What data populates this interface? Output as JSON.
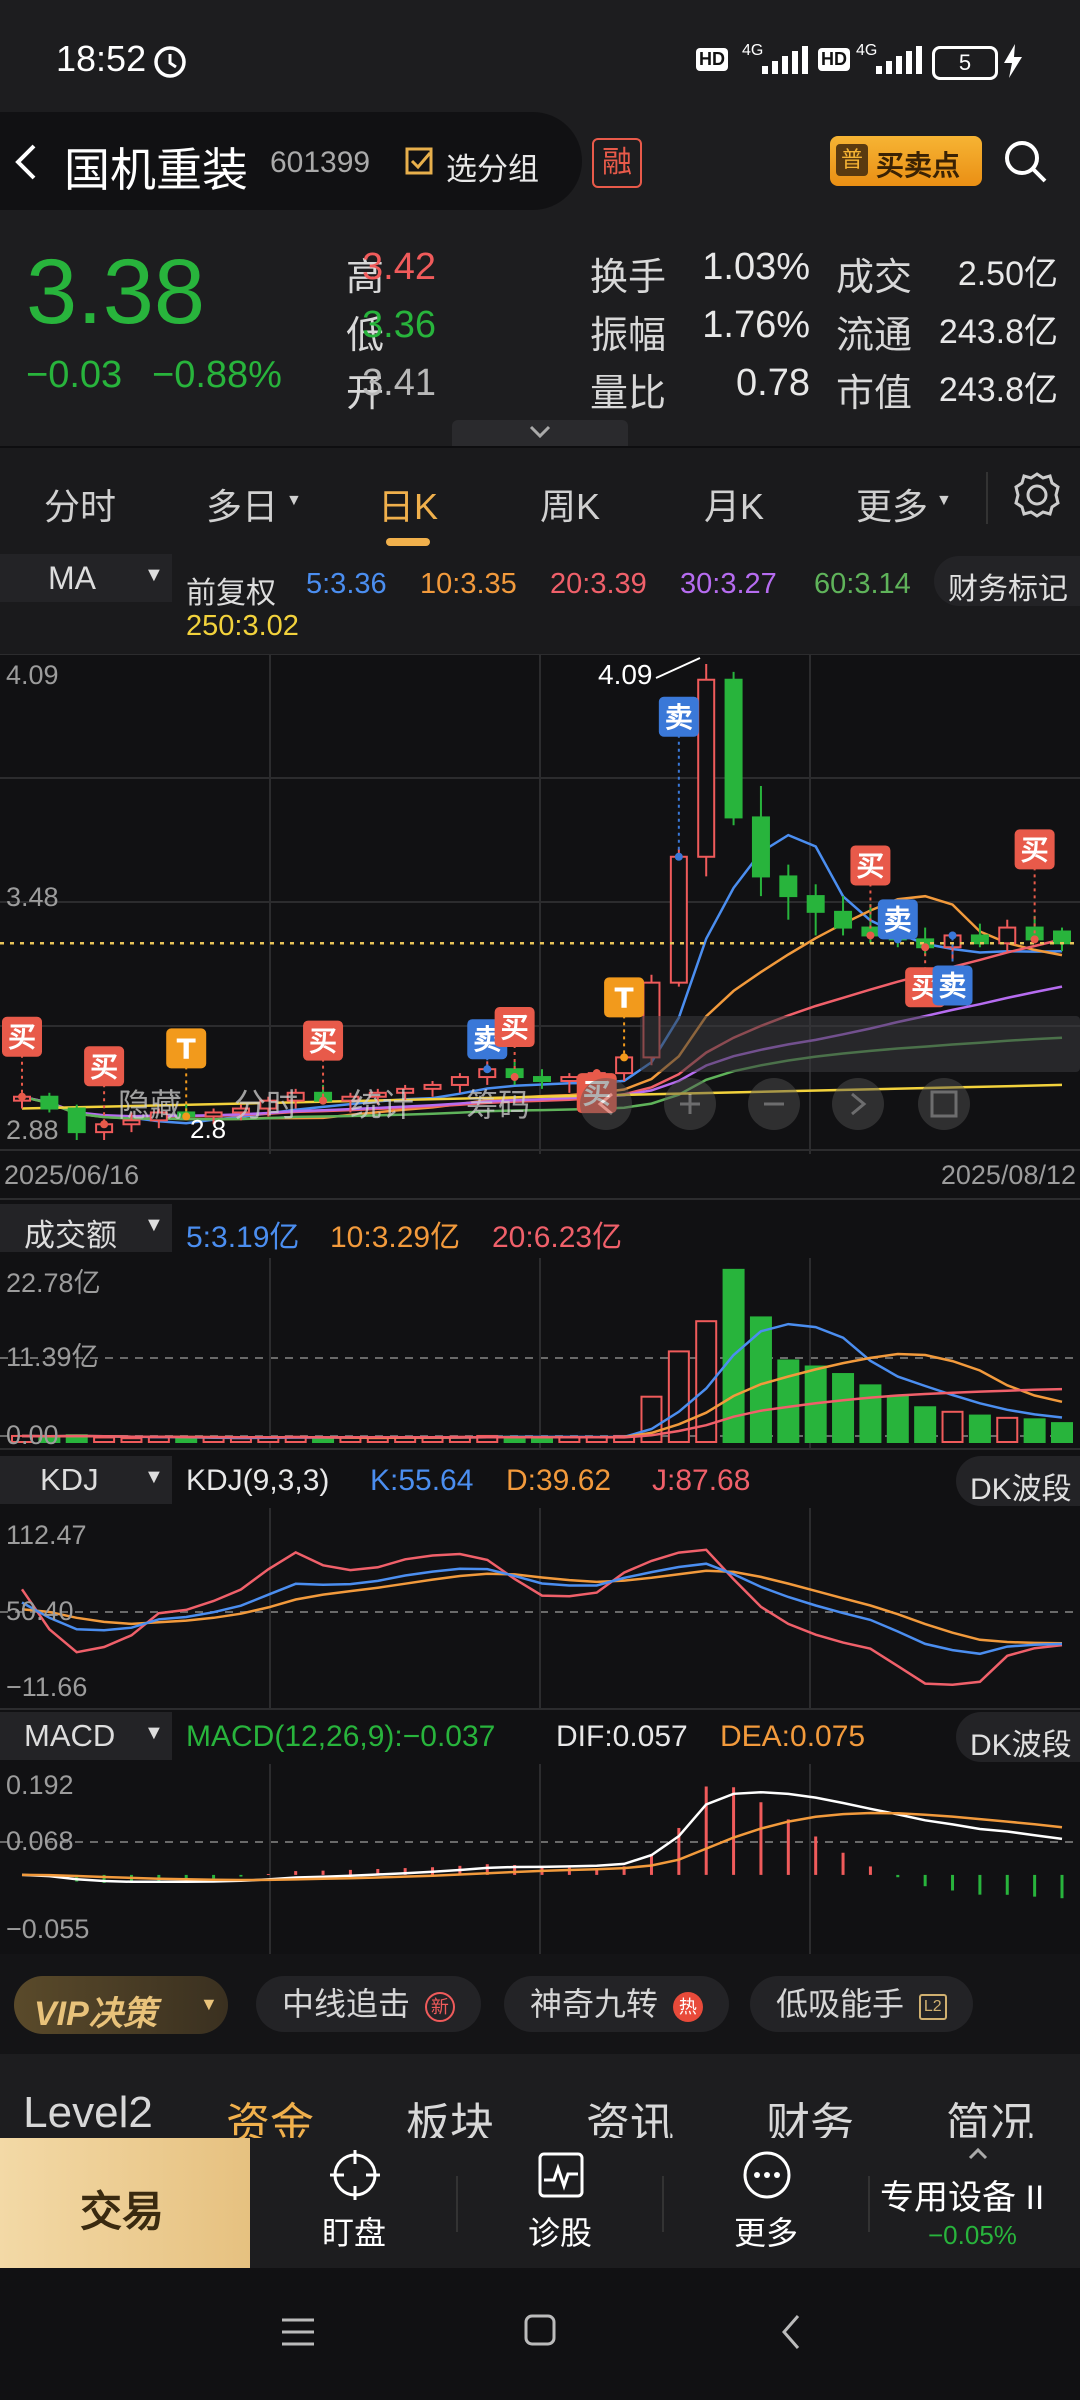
{
  "status_bar": {
    "time": "18:52",
    "battery": "5",
    "net1": "4G",
    "net2": "4G",
    "hd": "HD"
  },
  "header": {
    "stock_name": "国机重装",
    "stock_code": "601399",
    "group_label": "选分组",
    "margin_badge": "融",
    "buy_sell_label": "买卖点",
    "buy_sell_badge": "普"
  },
  "quote": {
    "price": "3.38",
    "change": "−0.03",
    "change_pct": "−0.88%",
    "rows": [
      [
        {
          "k": "高",
          "v": "3.42",
          "c": "red"
        },
        {
          "k": "换手",
          "v": "1.03%"
        },
        {
          "k": "成交",
          "v": "2.50亿"
        }
      ],
      [
        {
          "k": "低",
          "v": "3.36",
          "c": "green"
        },
        {
          "k": "振幅",
          "v": "1.76%"
        },
        {
          "k": "流通",
          "v": "243.8亿"
        }
      ],
      [
        {
          "k": "开",
          "v": "3.41",
          "c": "grey"
        },
        {
          "k": "量比",
          "v": "0.78"
        },
        {
          "k": "市值",
          "v": "243.8亿"
        }
      ]
    ]
  },
  "period_tabs": [
    "分时",
    "多日",
    "日K",
    "周K",
    "月K",
    "更多"
  ],
  "period_active": 2,
  "ma": {
    "selector": "MA",
    "adjust": "前复权",
    "ma5": "5:3.36",
    "ma10": "10:3.35",
    "ma20": "20:3.39",
    "ma30": "30:3.27",
    "ma60": "60:3.14",
    "ma250": "250:3.02",
    "finance_tag": "财务标记"
  },
  "price_axis": {
    "top": "4.09",
    "mid": "3.48",
    "bottom": "2.88",
    "peak_label": "4.09",
    "low_label": "2.8",
    "ref": "3.38"
  },
  "date_range": {
    "start": "2025/06/16",
    "end": "2025/08/12"
  },
  "overlay_toolbar": [
    "隐藏",
    "分时",
    "统计",
    "筹码"
  ],
  "signal_labels": {
    "buy": "买",
    "sell": "卖",
    "t": "T"
  },
  "volume": {
    "selector": "成交额",
    "ma5": "5:3.19亿",
    "ma10": "10:3.29亿",
    "ma20": "20:6.23亿",
    "axis_top": "22.78亿",
    "axis_mid": "11.39亿",
    "axis_bottom": "0.00"
  },
  "kdj": {
    "selector": "KDJ",
    "params": "KDJ(9,3,3)",
    "k": "K:55.64",
    "d": "D:39.62",
    "j": "J:87.68",
    "tag": "DK波段",
    "axis_top": "112.47",
    "axis_mid": "50.40",
    "axis_bottom": "−11.66"
  },
  "macd": {
    "selector": "MACD",
    "params": "MACD(12,26,9):−0.037",
    "dif": "DIF:0.057",
    "dea": "DEA:0.075",
    "tag": "DK波段",
    "axis_top": "0.192",
    "axis_mid": "0.068",
    "axis_bottom": "−0.055"
  },
  "strategy": {
    "vip": "VIP决策",
    "chips": [
      {
        "label": "中线追击",
        "badge": "新"
      },
      {
        "label": "神奇九转",
        "badge": "热"
      },
      {
        "label": "低吸能手",
        "badge": "L2"
      }
    ]
  },
  "info_tabs": [
    "Level2",
    "资金",
    "板块",
    "资讯",
    "财务",
    "简况"
  ],
  "trade_bar": {
    "trade": "交易",
    "items": [
      "盯盘",
      "诊股",
      "更多"
    ],
    "index_name": "专用设备 II",
    "index_change": "−0.05%"
  },
  "colors": {
    "up": "#f05b5b",
    "down": "#28b43c",
    "ma5": "#4b8ef0",
    "ma10": "#f29a3c",
    "ma20": "#f0606a",
    "ma30": "#b66cf0",
    "ma60": "#5fb35a",
    "ma250": "#f2d23c",
    "gold": "#f0a020"
  },
  "chart_data": {
    "type": "candlestick",
    "x_range": [
      "2025/06/16",
      "2025/08/12"
    ],
    "ylim": [
      2.88,
      4.09
    ],
    "ma_last": {
      "MA5": 3.36,
      "MA10": 3.35,
      "MA20": 3.39,
      "MA30": 3.27,
      "MA60": 3.14,
      "MA250": 3.02
    },
    "candles": [
      [
        2.98,
        3.0,
        2.96,
        2.99
      ],
      [
        2.99,
        3.0,
        2.95,
        2.96
      ],
      [
        2.96,
        2.97,
        2.88,
        2.9
      ],
      [
        2.9,
        2.93,
        2.88,
        2.92
      ],
      [
        2.92,
        2.95,
        2.9,
        2.93
      ],
      [
        2.93,
        2.96,
        2.91,
        2.95
      ],
      [
        2.95,
        2.97,
        2.93,
        2.94
      ],
      [
        2.94,
        2.96,
        2.92,
        2.95
      ],
      [
        2.95,
        2.97,
        2.93,
        2.96
      ],
      [
        2.96,
        2.99,
        2.94,
        2.98
      ],
      [
        2.98,
        3.01,
        2.96,
        3.0
      ],
      [
        3.0,
        3.02,
        2.97,
        2.98
      ],
      [
        2.98,
        3.0,
        2.95,
        2.99
      ],
      [
        2.99,
        3.01,
        2.97,
        3.0
      ],
      [
        3.0,
        3.02,
        2.98,
        3.01
      ],
      [
        3.01,
        3.03,
        2.99,
        3.02
      ],
      [
        3.02,
        3.05,
        3.0,
        3.04
      ],
      [
        3.04,
        3.08,
        3.02,
        3.06
      ],
      [
        3.06,
        3.08,
        3.02,
        3.04
      ],
      [
        3.04,
        3.06,
        3.01,
        3.03
      ],
      [
        3.03,
        3.05,
        3.0,
        3.04
      ],
      [
        3.04,
        3.06,
        3.01,
        3.05
      ],
      [
        3.05,
        3.1,
        3.03,
        3.09
      ],
      [
        3.09,
        3.3,
        3.07,
        3.28
      ],
      [
        3.28,
        3.62,
        3.27,
        3.6
      ],
      [
        3.6,
        4.09,
        3.55,
        4.05
      ],
      [
        4.05,
        4.07,
        3.68,
        3.7
      ],
      [
        3.7,
        3.78,
        3.5,
        3.55
      ],
      [
        3.55,
        3.58,
        3.44,
        3.5
      ],
      [
        3.5,
        3.53,
        3.4,
        3.46
      ],
      [
        3.46,
        3.5,
        3.4,
        3.42
      ],
      [
        3.42,
        3.48,
        3.38,
        3.4
      ],
      [
        3.4,
        3.44,
        3.37,
        3.39
      ],
      [
        3.39,
        3.42,
        3.35,
        3.37
      ],
      [
        3.37,
        3.41,
        3.34,
        3.4
      ],
      [
        3.4,
        3.43,
        3.37,
        3.38
      ],
      [
        3.38,
        3.44,
        3.36,
        3.42
      ],
      [
        3.42,
        3.45,
        3.38,
        3.39
      ],
      [
        3.41,
        3.42,
        3.36,
        3.38
      ]
    ],
    "volume_yi": [
      0.8,
      0.7,
      0.9,
      0.6,
      0.5,
      0.6,
      0.5,
      0.6,
      0.5,
      0.6,
      0.7,
      0.6,
      0.6,
      0.5,
      0.6,
      0.6,
      0.7,
      0.8,
      0.7,
      0.6,
      0.6,
      0.6,
      0.8,
      6.0,
      12.0,
      16.0,
      22.8,
      16.5,
      10.8,
      10.0,
      9.0,
      7.5,
      6.0,
      4.6,
      4.0,
      3.5,
      3.2,
      3.0,
      2.5
    ]
  }
}
